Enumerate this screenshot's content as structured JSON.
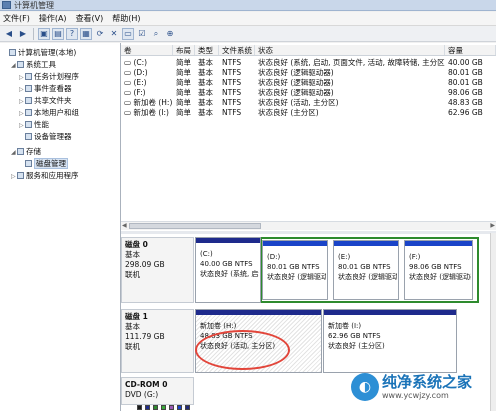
{
  "window": {
    "title": "计算机管理"
  },
  "menu": [
    "文件(F)",
    "操作(A)",
    "查看(V)",
    "帮助(H)"
  ],
  "toolbar": {
    "icons": [
      "back-icon",
      "forward-icon",
      "up-folder-icon",
      "show-hide-tree-icon",
      "help-icon",
      "properties-icon",
      "refresh-icon",
      "delete-icon",
      "export-icon",
      "check-icon",
      "search-icon",
      "zoom-icon"
    ],
    "glyphs": [
      "◀",
      "▶",
      "▣",
      "▤",
      "?",
      "▦",
      "⟳",
      "✕",
      "▭",
      "☑",
      "⌕",
      "⊕"
    ]
  },
  "tree": [
    {
      "label": "计算机管理(本地)",
      "level": 0,
      "expander": ""
    },
    {
      "label": "系统工具",
      "level": 1,
      "expander": "◢"
    },
    {
      "label": "任务计划程序",
      "level": 2,
      "expander": "▷"
    },
    {
      "label": "事件查看器",
      "level": 2,
      "expander": "▷"
    },
    {
      "label": "共享文件夹",
      "level": 2,
      "expander": "▷"
    },
    {
      "label": "本地用户和组",
      "level": 2,
      "expander": "▷"
    },
    {
      "label": "性能",
      "level": 2,
      "expander": "▷"
    },
    {
      "label": "设备管理器",
      "level": 2,
      "expander": ""
    },
    {
      "label": "存储",
      "level": 1,
      "expander": "◢"
    },
    {
      "label": "磁盘管理",
      "level": 2,
      "expander": "",
      "selected": true
    },
    {
      "label": "服务和应用程序",
      "level": 1,
      "expander": "▷"
    }
  ],
  "volumes": {
    "columns": [
      "卷",
      "布局",
      "类型",
      "文件系统",
      "状态",
      "容量"
    ],
    "rows": [
      [
        "(C:)",
        "简单",
        "基本",
        "NTFS",
        "状态良好 (系统, 启动, 页面文件, 活动, 故障转储, 主分区)",
        "40.00 GB"
      ],
      [
        "(D:)",
        "简单",
        "基本",
        "NTFS",
        "状态良好 (逻辑驱动器)",
        "80.01 GB"
      ],
      [
        "(E:)",
        "简单",
        "基本",
        "NTFS",
        "状态良好 (逻辑驱动器)",
        "80.01 GB"
      ],
      [
        "(F:)",
        "简单",
        "基本",
        "NTFS",
        "状态良好 (逻辑驱动器)",
        "98.06 GB"
      ],
      [
        "新加卷 (H:)",
        "简单",
        "基本",
        "NTFS",
        "状态良好 (活动, 主分区)",
        "48.83 GB"
      ],
      [
        "新加卷 (I:)",
        "简单",
        "基本",
        "NTFS",
        "状态良好 (主分区)",
        "62.96 GB"
      ]
    ]
  },
  "disks": [
    {
      "name": "磁盘 0",
      "type": "基本",
      "size": "298.09 GB",
      "status": "联机",
      "partitions": [
        {
          "title": "(C:)",
          "size": "40.00 GB NTFS",
          "status": "状态良好 (系统, 启动",
          "color": "#1e2a8c",
          "hatched": false
        },
        {
          "title": "(D:)",
          "size": "80.01 GB NTFS",
          "status": "状态良好 (逻辑驱动器",
          "color": "#1a44c8",
          "hatched": false
        },
        {
          "title": "(E:)",
          "size": "80.01 GB NTFS",
          "status": "状态良好 (逻辑驱动器",
          "color": "#1a44c8",
          "hatched": false
        },
        {
          "title": "(F:)",
          "size": "98.06 GB NTFS",
          "status": "状态良好 (逻辑驱动器",
          "color": "#1a44c8",
          "hatched": false
        }
      ]
    },
    {
      "name": "磁盘 1",
      "type": "基本",
      "size": "111.79 GB",
      "status": "联机",
      "partitions": [
        {
          "title": "新加卷 (H:)",
          "size": "48.83 GB NTFS",
          "status": "状态良好 (活动, 主分区)",
          "color": "#1e2a8c",
          "hatched": true
        },
        {
          "title": "新加卷 (I:)",
          "size": "62.96 GB NTFS",
          "status": "状态良好 (主分区)",
          "color": "#1e2a8c",
          "hatched": false
        }
      ]
    },
    {
      "name": "CD-ROM 0",
      "type": "DVD (G:)",
      "size": "",
      "status": "",
      "partitions": []
    }
  ],
  "legend": [
    "#1a1a1a",
    "#1e2a8c",
    "#2e8b2e",
    "#3aa83a",
    "#9b59b6",
    "#1a44c8",
    "#222a7a"
  ],
  "watermark": {
    "title": "纯净系统之家",
    "url": "www.ycwjzy.com",
    "logo": "◐"
  }
}
